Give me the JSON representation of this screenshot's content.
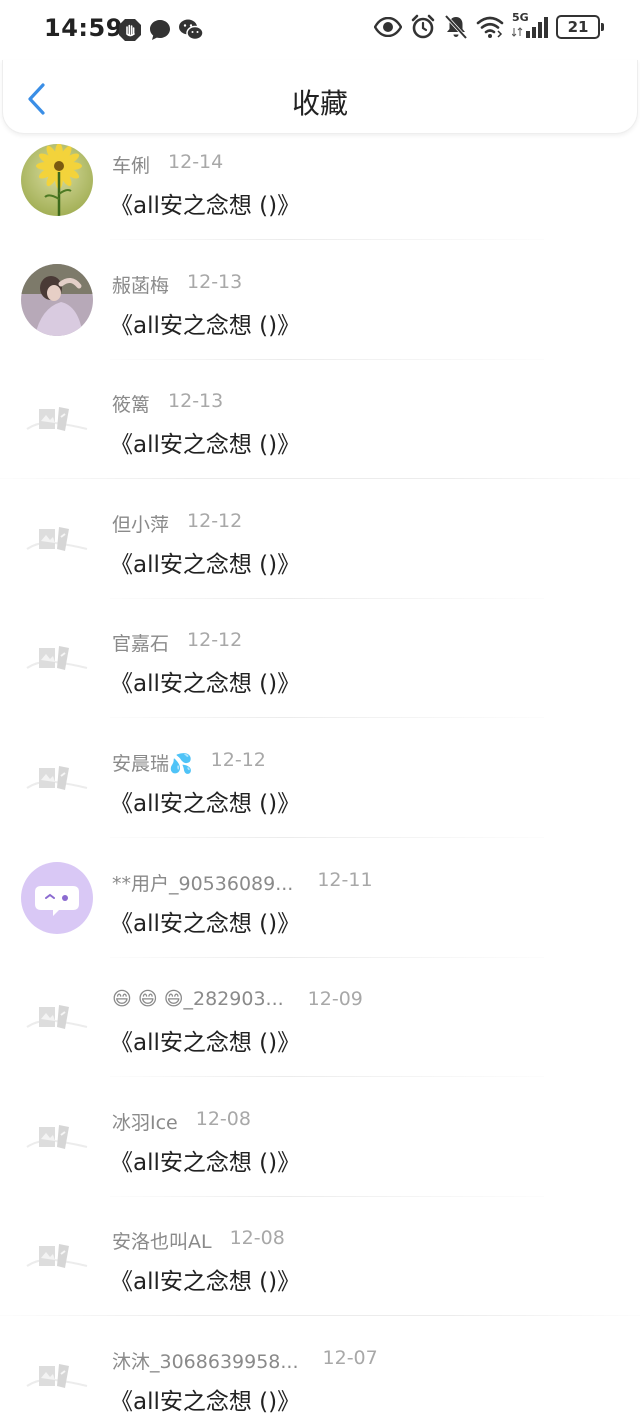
{
  "status_bar": {
    "time": "14:59",
    "network": "5G",
    "battery": "21"
  },
  "header": {
    "title": "收藏"
  },
  "items": [
    {
      "name": "车俐",
      "date": "12-14",
      "content": "《all安之念想 ()》",
      "avatar": "flower"
    },
    {
      "name": "赧菡梅",
      "date": "12-13",
      "content": "《all安之念想 ()》",
      "avatar": "girl-photo"
    },
    {
      "name": "筱篱",
      "date": "12-13",
      "content": "《all安之念想 ()》",
      "avatar": "placeholder"
    },
    {
      "name": "但小萍",
      "date": "12-12",
      "content": "《all安之念想 ()》",
      "avatar": "placeholder"
    },
    {
      "name": "官嘉石",
      "date": "12-12",
      "content": "《all安之念想 ()》",
      "avatar": "placeholder"
    },
    {
      "name": "安晨瑞💦",
      "date": "12-12",
      "content": "《all安之念想 ()》",
      "avatar": "placeholder"
    },
    {
      "name": "**用户_90536089...",
      "date": "12-11",
      "content": "《all安之念想 ()》",
      "avatar": "chat-bubble"
    },
    {
      "name": "😄 😄 😄_282903...",
      "date": "12-09",
      "content": "《all安之念想 ()》",
      "avatar": "placeholder"
    },
    {
      "name": "冰羽Ice",
      "date": "12-08",
      "content": "《all安之念想 ()》",
      "avatar": "placeholder"
    },
    {
      "name": "安洛也叫AL",
      "date": "12-08",
      "content": "《all安之念想 ()》",
      "avatar": "placeholder"
    },
    {
      "name": "沐沐_3068639958...",
      "date": "12-07",
      "content": "《all安之念想 ()》",
      "avatar": "placeholder"
    }
  ],
  "colors": {
    "accent": "#3a8ee6",
    "text_primary": "#222222",
    "text_secondary": "#8a8a8a",
    "chat_avatar_bg": "#d9c8f5"
  }
}
